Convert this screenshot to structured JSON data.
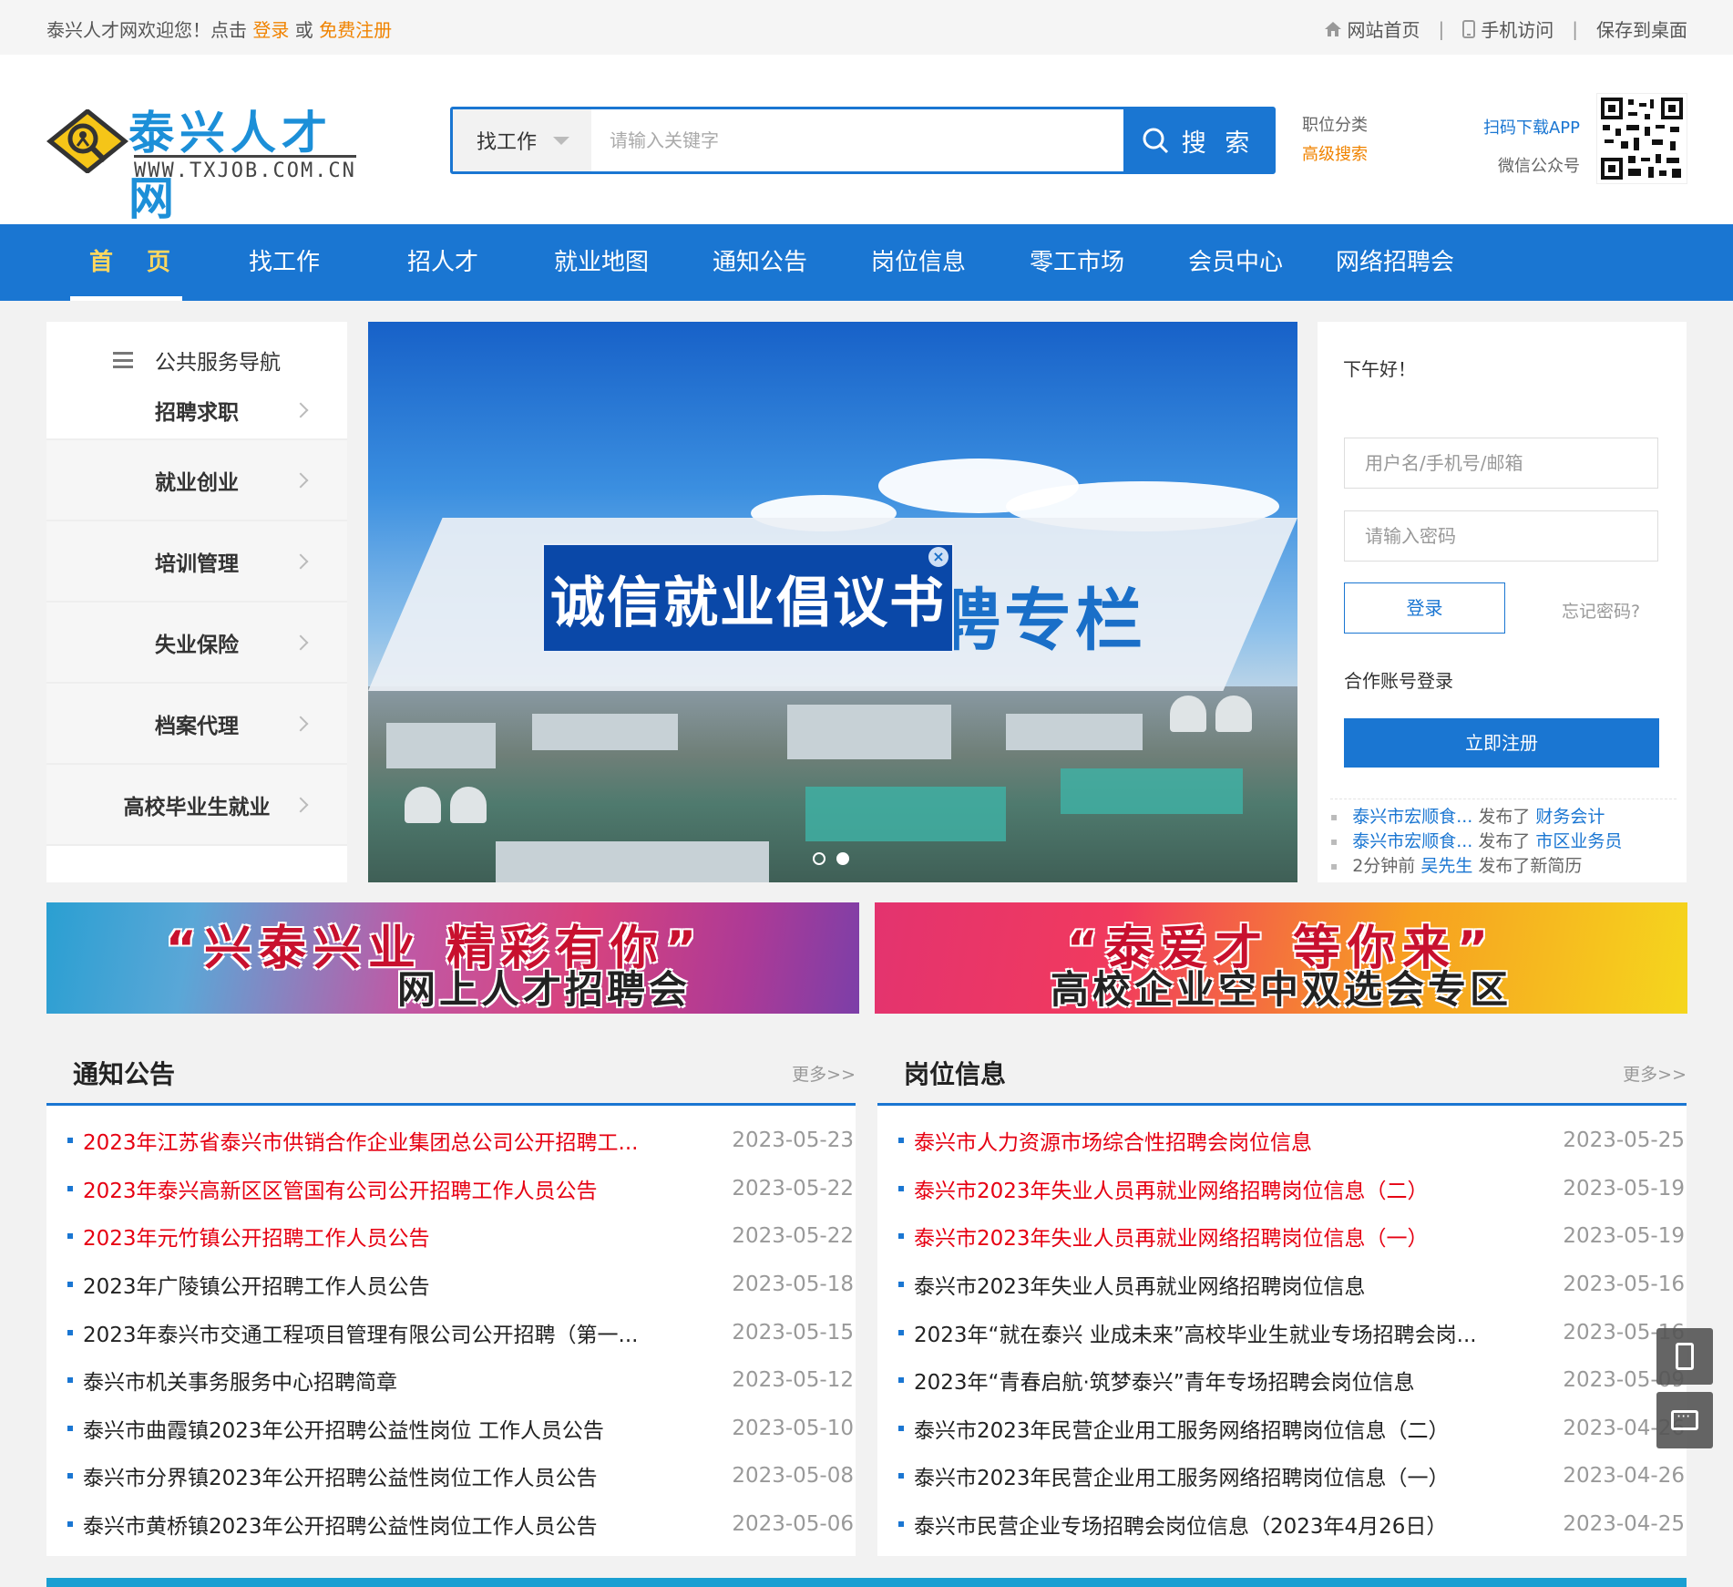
{
  "topbar": {
    "welcome_prefix": "泰兴人才网欢迎您！点击",
    "login": "登录",
    "or": "或",
    "register": "免费注册",
    "home": "网站首页",
    "mobile": "手机访问",
    "save_desktop": "保存到桌面"
  },
  "header": {
    "logo_title": "泰兴人才网",
    "logo_url": "WWW.TXJOB.COM.CN",
    "search_type": "找工作",
    "search_placeholder": "请输入关键字",
    "search_button": "搜 索",
    "job_category": "职位分类",
    "advanced_search": "高级搜索",
    "scan_app": "扫码下载APP",
    "wechat": "微信公众号"
  },
  "nav": [
    "首 页",
    "找工作",
    "招人才",
    "就业地图",
    "通知公告",
    "岗位信息",
    "零工市场",
    "会员中心",
    "网络招聘会"
  ],
  "sidebar": {
    "title": "公共服务导航",
    "items": [
      "招聘求职",
      "就业创业",
      "培训管理",
      "失业保险",
      "档案代理",
      "高校毕业生就业"
    ]
  },
  "banner": {
    "popup_text": "诚信就业倡议书",
    "band_text": "聘专栏",
    "slides": 2,
    "active_slide": 2
  },
  "login": {
    "greeting": "下午好！",
    "username_placeholder": "用户名/手机号/邮箱",
    "password_placeholder": "请输入密码",
    "login_button": "登录",
    "forgot": "忘记密码?",
    "partner": "合作账号登录",
    "register_button": "立即注册",
    "feed": [
      {
        "who": "泰兴市宏顺食...",
        "action": "发布了",
        "what": "财务会计"
      },
      {
        "who": "泰兴市宏顺食...",
        "action": "发布了",
        "what": "市区业务员"
      },
      {
        "who": "2分钟前",
        "action": "发布了新简历",
        "what": "吴先生"
      }
    ]
  },
  "promos": [
    {
      "line1": "“兴泰兴业  精彩有你”",
      "line2": "网上人才招聘会"
    },
    {
      "line1": "“泰爱才  等你来”",
      "line2": "高校企业空中双选会专区"
    }
  ],
  "notices": {
    "title": "通知公告",
    "more": "更多>>",
    "items": [
      {
        "title": "2023年江苏省泰兴市供销合作企业集团总公司公开招聘工...",
        "date": "2023-05-23",
        "red": true
      },
      {
        "title": "2023年泰兴高新区区管国有公司公开招聘工作人员公告",
        "date": "2023-05-22",
        "red": true
      },
      {
        "title": "2023年元竹镇公开招聘工作人员公告",
        "date": "2023-05-22",
        "red": true
      },
      {
        "title": "2023年广陵镇公开招聘工作人员公告",
        "date": "2023-05-18",
        "red": false
      },
      {
        "title": "2023年泰兴市交通工程项目管理有限公司公开招聘（第一...",
        "date": "2023-05-15",
        "red": false
      },
      {
        "title": "泰兴市机关事务服务中心招聘简章",
        "date": "2023-05-12",
        "red": false
      },
      {
        "title": "泰兴市曲霞镇2023年公开招聘公益性岗位 工作人员公告",
        "date": "2023-05-10",
        "red": false
      },
      {
        "title": "泰兴市分界镇2023年公开招聘公益性岗位工作人员公告",
        "date": "2023-05-08",
        "red": false
      },
      {
        "title": "泰兴市黄桥镇2023年公开招聘公益性岗位工作人员公告",
        "date": "2023-05-06",
        "red": false
      }
    ]
  },
  "jobs": {
    "title": "岗位信息",
    "more": "更多>>",
    "items": [
      {
        "title": "泰兴市人力资源市场综合性招聘会岗位信息",
        "date": "2023-05-25",
        "red": true
      },
      {
        "title": "泰兴市2023年失业人员再就业网络招聘岗位信息（二）",
        "date": "2023-05-19",
        "red": true
      },
      {
        "title": "泰兴市2023年失业人员再就业网络招聘岗位信息（一）",
        "date": "2023-05-19",
        "red": true
      },
      {
        "title": "泰兴市2023年失业人员再就业网络招聘岗位信息",
        "date": "2023-05-16",
        "red": false
      },
      {
        "title": "2023年“就在泰兴 业成未来”高校毕业生就业专场招聘会岗...",
        "date": "2023-05-16",
        "red": false
      },
      {
        "title": "2023年“青春启航·筑梦泰兴”青年专场招聘会岗位信息",
        "date": "2023-05-09",
        "red": false
      },
      {
        "title": "泰兴市2023年民营企业用工服务网络招聘岗位信息（二）",
        "date": "2023-04-26",
        "red": false
      },
      {
        "title": "泰兴市2023年民营企业用工服务网络招聘岗位信息（一）",
        "date": "2023-04-26",
        "red": false
      },
      {
        "title": "泰兴市民营企业专场招聘会岗位信息（2023年4月26日）",
        "date": "2023-04-25",
        "red": false
      }
    ]
  },
  "colors": {
    "brand_blue": "#1a76d2",
    "accent_orange": "#f08300",
    "alert_red": "#e60012"
  }
}
